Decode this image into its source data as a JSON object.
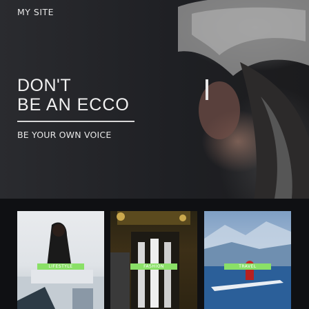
{
  "site": {
    "name": "MY SITE"
  },
  "hero": {
    "headline_line1": "DON'T",
    "headline_line2": "BE AN ECCO",
    "tagline": "BE YOUR OWN VOICE"
  },
  "categories": [
    {
      "label": "LIFESTYLE"
    },
    {
      "label": "FASHION"
    },
    {
      "label": "TRAVEL"
    }
  ],
  "colors": {
    "label_bg": "#8ae067",
    "hero_bg": "#1f2024"
  }
}
